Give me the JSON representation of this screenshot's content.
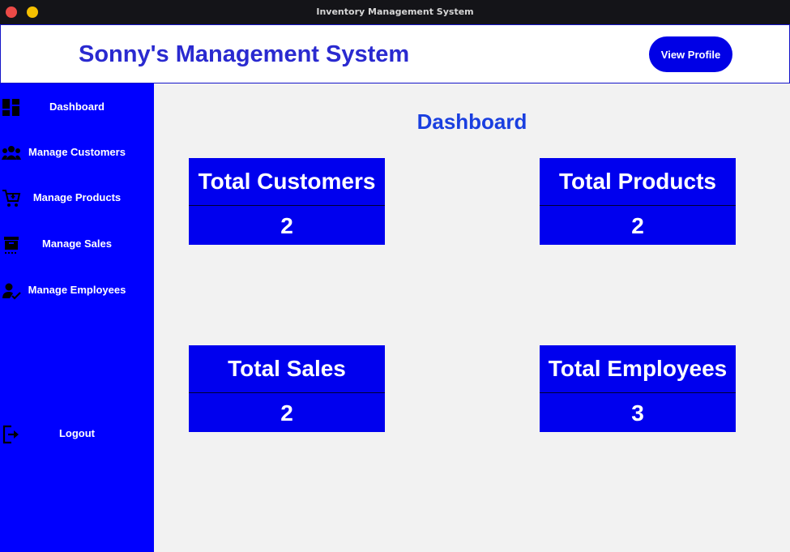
{
  "window": {
    "title": "Inventory Management System"
  },
  "header": {
    "title": "Sonny's Management System",
    "profile_button": "View Profile"
  },
  "sidebar": {
    "items": [
      {
        "label": "Dashboard",
        "icon": "dashboard-icon"
      },
      {
        "label": "Manage Customers",
        "icon": "customers-icon"
      },
      {
        "label": "Manage Products",
        "icon": "cart-icon"
      },
      {
        "label": "Manage Sales",
        "icon": "sales-icon"
      },
      {
        "label": "Manage Employees",
        "icon": "employee-check-icon"
      }
    ],
    "logout": {
      "label": "Logout",
      "icon": "logout-icon"
    }
  },
  "main": {
    "heading": "Dashboard",
    "cards": [
      {
        "title": "Total Customers",
        "value": "2"
      },
      {
        "title": "Total Products",
        "value": "2"
      },
      {
        "title": "Total Sales",
        "value": "2"
      },
      {
        "title": "Total Employees",
        "value": "3"
      }
    ]
  },
  "colors": {
    "sidebar": "#0000ff",
    "card": "#0000ee",
    "title_text": "#2a2ad0",
    "heading_text": "#1a3fe0",
    "button": "#0000e6",
    "titlebar": "#141418"
  }
}
